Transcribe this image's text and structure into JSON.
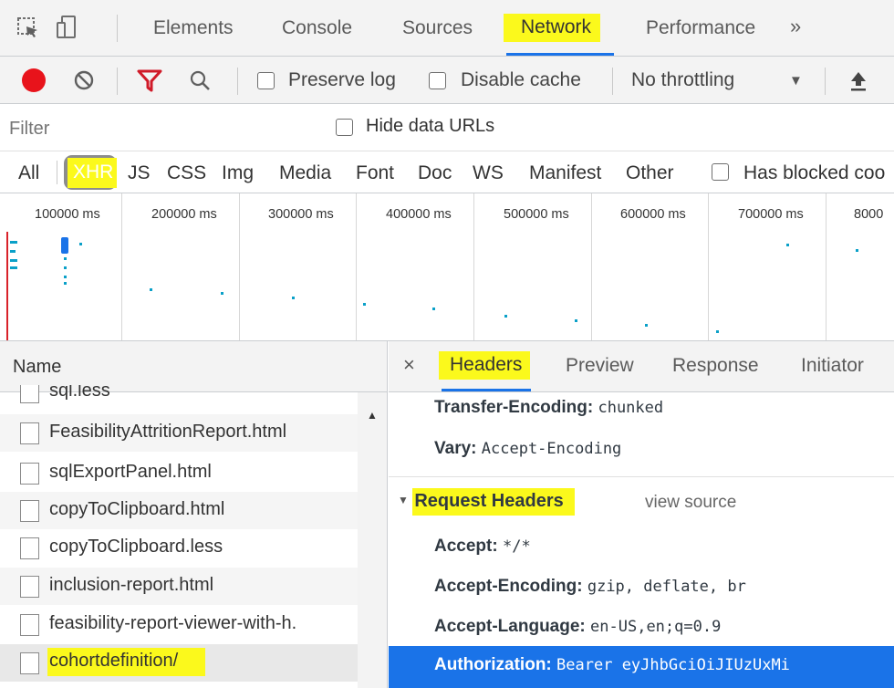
{
  "tabs": {
    "elements": "Elements",
    "console": "Console",
    "sources": "Sources",
    "network": "Network",
    "performance": "Performance",
    "more": "»"
  },
  "toolbar": {
    "preserve_log": "Preserve log",
    "disable_cache": "Disable cache",
    "throttling": "No throttling",
    "dropdown_arrow": "▼",
    "upload": "⬆"
  },
  "filter": {
    "placeholder": "Filter",
    "hide_data_urls": "Hide data URLs"
  },
  "types": {
    "all": "All",
    "xhr": "XHR",
    "js": "JS",
    "css": "CSS",
    "img": "Img",
    "media": "Media",
    "font": "Font",
    "doc": "Doc",
    "ws": "WS",
    "manifest": "Manifest",
    "other": "Other",
    "blocked": "Has blocked coo"
  },
  "timeline": {
    "ticks": [
      "100000 ms",
      "200000 ms",
      "300000 ms",
      "400000 ms",
      "500000 ms",
      "600000 ms",
      "700000 ms",
      "8000"
    ]
  },
  "namepane": {
    "header": "Name",
    "rows": [
      "sql.less",
      "FeasibilityAttritionReport.html",
      "sqlExportPanel.html",
      "copyToClipboard.html",
      "copyToClipboard.less",
      "inclusion-report.html",
      "feasibility-report-viewer-with-h.",
      "cohortdefinition/"
    ]
  },
  "detail": {
    "close": "×",
    "tabs": {
      "headers": "Headers",
      "preview": "Preview",
      "response": "Response",
      "initiator": "Initiator"
    },
    "response_headers": [
      {
        "key": "Transfer-Encoding:",
        "value": "chunked"
      },
      {
        "key": "Vary:",
        "value": "Accept-Encoding"
      }
    ],
    "request_section": {
      "title": "Request Headers",
      "view_source": "view source",
      "toggle": "▼"
    },
    "request_headers": [
      {
        "key": "Accept:",
        "value": "*/*"
      },
      {
        "key": "Accept-Encoding:",
        "value": "gzip, deflate, br"
      },
      {
        "key": "Accept-Language:",
        "value": "en-US,en;q=0.9"
      },
      {
        "key": "Authorization:",
        "value": "Bearer eyJhbGciOiJIUzUxMi"
      }
    ]
  },
  "colors": {
    "highlight": "#fbf91c",
    "selected_row": "#1a73e8",
    "record": "#e8131b",
    "filter_red": "#d01a28",
    "timeline_dots": "#0aa0c8"
  }
}
